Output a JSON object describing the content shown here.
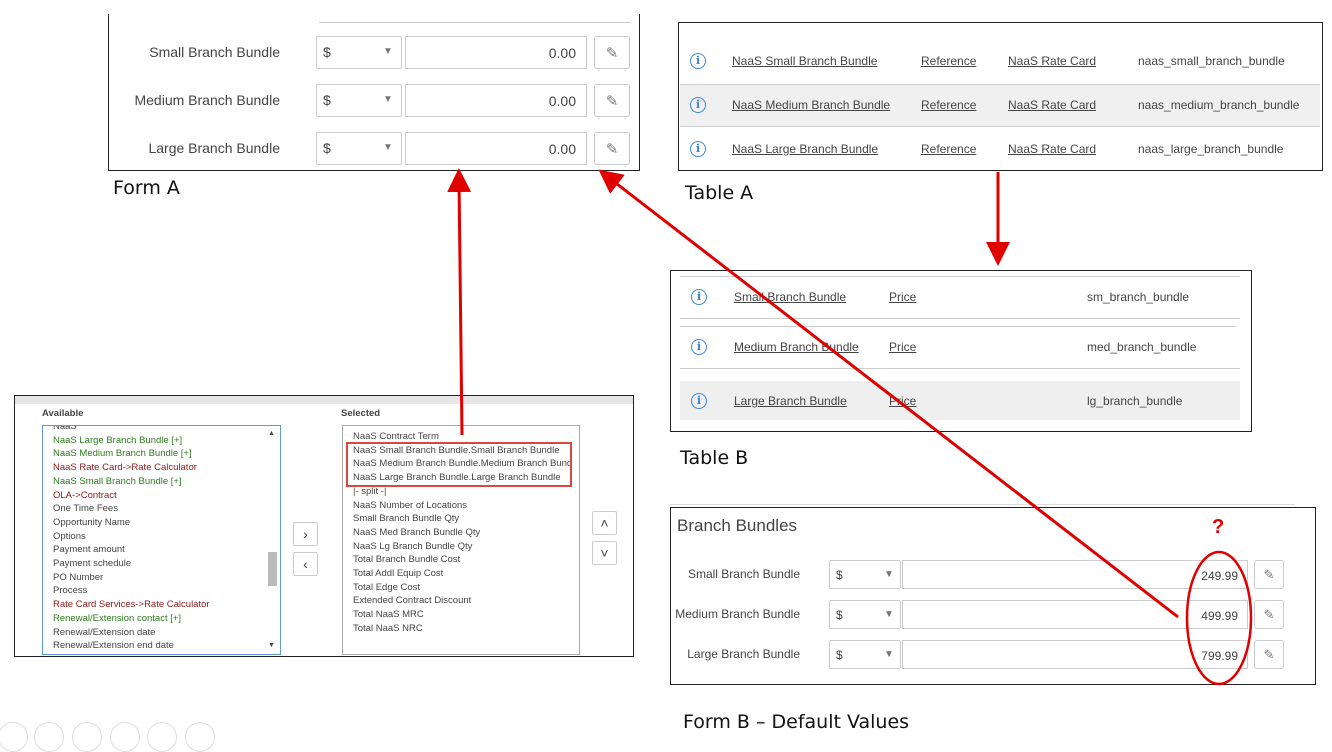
{
  "form_a": {
    "caption": "Form A",
    "rows": [
      {
        "label": "Small Branch Bundle",
        "currency": "$",
        "value": "0.00"
      },
      {
        "label": "Medium Branch Bundle",
        "currency": "$",
        "value": "0.00"
      },
      {
        "label": "Large Branch Bundle",
        "currency": "$",
        "value": "0.00"
      }
    ]
  },
  "table_a": {
    "caption": "Table A",
    "rows": [
      {
        "name": "NaaS Small Branch Bundle",
        "type": "Reference",
        "ref": "NaaS Rate Card",
        "column": "naas_small_branch_bundle"
      },
      {
        "name": "NaaS Medium Branch Bundle",
        "type": "Reference",
        "ref": "NaaS Rate Card",
        "column": "naas_medium_branch_bundle"
      },
      {
        "name": "NaaS Large Branch Bundle",
        "type": "Reference",
        "ref": "NaaS Rate Card",
        "column": "naas_large_branch_bundle"
      }
    ]
  },
  "table_b": {
    "caption": "Table B",
    "rows": [
      {
        "name": "Small Branch Bundle",
        "type": "Price",
        "column": "sm_branch_bundle"
      },
      {
        "name": "Medium Branch Bundle",
        "type": "Price",
        "column": "med_branch_bundle"
      },
      {
        "name": "Large Branch Bundle",
        "type": "Price",
        "column": "lg_branch_bundle"
      }
    ]
  },
  "slush": {
    "available_label": "Available",
    "selected_label": "Selected",
    "available": [
      {
        "t": "NaaS",
        "c": "k"
      },
      {
        "t": "NaaS Large Branch Bundle [+]",
        "c": "g"
      },
      {
        "t": "NaaS Medium Branch Bundle [+]",
        "c": "g"
      },
      {
        "t": "NaaS Rate Card->Rate Calculator",
        "c": "r"
      },
      {
        "t": "NaaS Small Branch Bundle [+]",
        "c": "g"
      },
      {
        "t": "OLA->Contract",
        "c": "r"
      },
      {
        "t": "One Time Fees",
        "c": "k"
      },
      {
        "t": "Opportunity Name",
        "c": "k"
      },
      {
        "t": "Options",
        "c": "k"
      },
      {
        "t": "Payment amount",
        "c": "k"
      },
      {
        "t": "Payment schedule",
        "c": "k"
      },
      {
        "t": "PO Number",
        "c": "k"
      },
      {
        "t": "Process",
        "c": "k"
      },
      {
        "t": "Rate Card Services->Rate Calculator",
        "c": "r"
      },
      {
        "t": "Renewal/Extension contact [+]",
        "c": "g"
      },
      {
        "t": "Renewal/Extension date",
        "c": "k"
      },
      {
        "t": "Renewal/Extension end date",
        "c": "k"
      }
    ],
    "selected": [
      "NaaS Contract Term",
      "NaaS Small Branch Bundle.Small Branch Bundle",
      "NaaS Medium Branch Bundle.Medium Branch Bund",
      "NaaS Large Branch Bundle.Large Branch Bundle",
      "|- split -|",
      "NaaS Number of Locations",
      "Small Branch Bundle Qty",
      "NaaS Med Branch Bundle Qty",
      "NaaS Lg Branch Bundle Qty",
      "Total Branch Bundle Cost",
      "Total Addl Equip Cost",
      "Total Edge Cost",
      "Extended Contract Discount",
      "Total NaaS MRC",
      "Total NaaS NRC"
    ],
    "add": "›",
    "remove": "‹",
    "up": "˄",
    "down": "˅"
  },
  "form_b": {
    "caption": "Form B – Default Values",
    "title": "Branch Bundles",
    "question": "?",
    "rows": [
      {
        "label": "Small Branch Bundle",
        "currency": "$",
        "value": "249.99"
      },
      {
        "label": "Medium Branch Bundle",
        "currency": "$",
        "value": "499.99"
      },
      {
        "label": "Large Branch Bundle",
        "currency": "$",
        "value": "799.99"
      }
    ]
  },
  "colors": {
    "annotation": "#e00000",
    "info": "#3a86d6"
  }
}
